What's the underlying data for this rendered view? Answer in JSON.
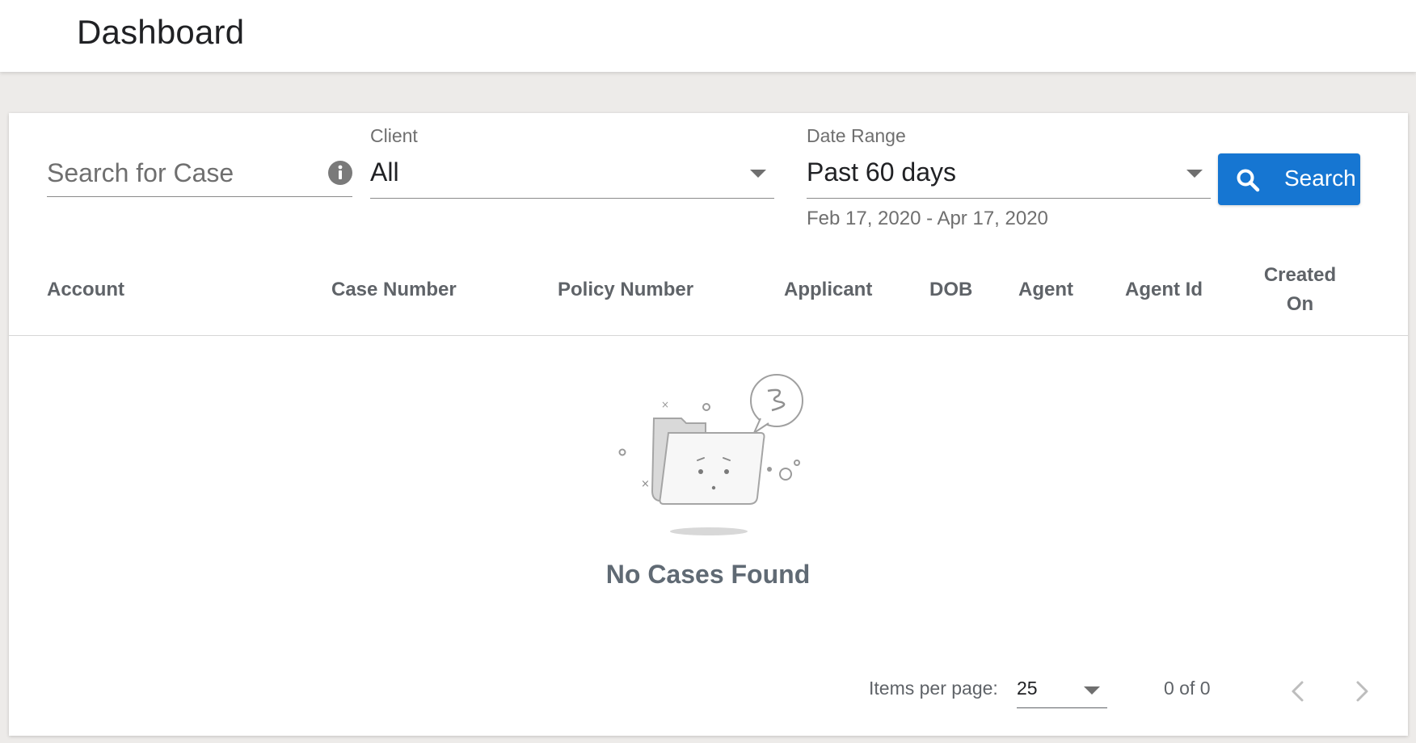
{
  "header": {
    "title": "Dashboard"
  },
  "filters": {
    "search": {
      "placeholder": "Search for Case",
      "info_icon": "info-icon"
    },
    "client": {
      "label": "Client",
      "value": "All"
    },
    "date_range": {
      "label": "Date Range",
      "value": "Past 60 days",
      "hint": "Feb 17, 2020 - Apr 17, 2020"
    },
    "search_button": {
      "label": "Search",
      "icon": "search-icon"
    }
  },
  "table": {
    "columns": [
      {
        "label": "Account"
      },
      {
        "label": "Case Number"
      },
      {
        "label": "Policy Number"
      },
      {
        "label": "Applicant"
      },
      {
        "label": "DOB"
      },
      {
        "label": "Agent"
      },
      {
        "label": "Agent Id"
      },
      {
        "label": "Created On"
      }
    ],
    "empty_state": {
      "message": "No Cases Found",
      "illustration": "empty-folder-illustration"
    }
  },
  "pagination": {
    "items_per_page_label": "Items per page:",
    "items_per_page_value": "25",
    "range_label": "0 of 0"
  },
  "colors": {
    "primary": "#1676d2",
    "page_bg": "#edebe9",
    "text": "#202124",
    "muted": "#6f6f6f"
  }
}
